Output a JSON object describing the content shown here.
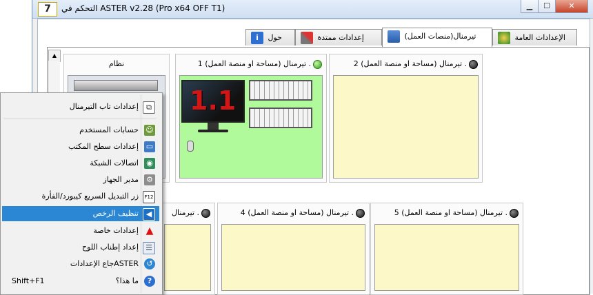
{
  "window": {
    "title": "التحكم في ASTER v2.28 (Pro x64 OFF T1)",
    "app_icon_text": "7"
  },
  "tabs": [
    {
      "label": "الإعدادات العامة",
      "icon": "settings-icon"
    },
    {
      "label": "تيرمنال(منصات العمل)",
      "icon": "workstations-icon",
      "active": true
    },
    {
      "label": "إعدادات ممتدة",
      "icon": "tools-icon"
    },
    {
      "label": "حول",
      "icon": "info-icon"
    }
  ],
  "system_panel": {
    "label": "نظام"
  },
  "terminals": [
    {
      "number": "1",
      "label": ". تيرمنال (مساحة او منصة العمل)",
      "status": "active",
      "screen_text": "1.1"
    },
    {
      "number": "2",
      "label": ". تيرمنال (مساحة او منصة العمل)",
      "status": "inactive"
    },
    {
      "number": "4",
      "label": ". تيرمنال (مساحة او منصة العمل)",
      "status": "inactive"
    },
    {
      "number": "5",
      "label": ". تيرمنال (مساحة او منصة العمل)",
      "status": "inactive"
    }
  ],
  "terminal3_partial_label": ". تيرمنال",
  "context_menu": [
    {
      "label": "إعدادات تاب التيرمنال",
      "icon": "tab-settings-icon"
    },
    {
      "label": "حسابات المستخدم",
      "icon": "users-icon"
    },
    {
      "label": "إعدادات سطح المكتب",
      "icon": "desktop-icon"
    },
    {
      "label": "اتصالات الشبكة",
      "icon": "network-icon"
    },
    {
      "label": "مدير الجهاز",
      "icon": "device-manager-icon"
    },
    {
      "label": "زر التبديل السريع كيبورد/الفأرة",
      "icon": "f12-key-icon",
      "icon_text": "F12"
    },
    {
      "label": "تنظيف الرخص",
      "icon": "clean-license-icon",
      "highlighted": true
    },
    {
      "label": "إعدادات خاصة",
      "icon": "warning-icon"
    },
    {
      "label": "إعداد إطناب اللوح",
      "icon": "board-icon"
    },
    {
      "label": "ASTERجاع الإعدادات",
      "icon": "restore-icon"
    },
    {
      "label": "ما هذا؟",
      "icon": "help-icon",
      "shortcut": "Shift+F1"
    }
  ],
  "colors": {
    "active_panel": "#b1fa9b",
    "inactive_panel": "#fdf8c8",
    "menu_highlight": "#2b86d3",
    "status_active": "#2c9d15",
    "status_inactive": "#111111"
  }
}
